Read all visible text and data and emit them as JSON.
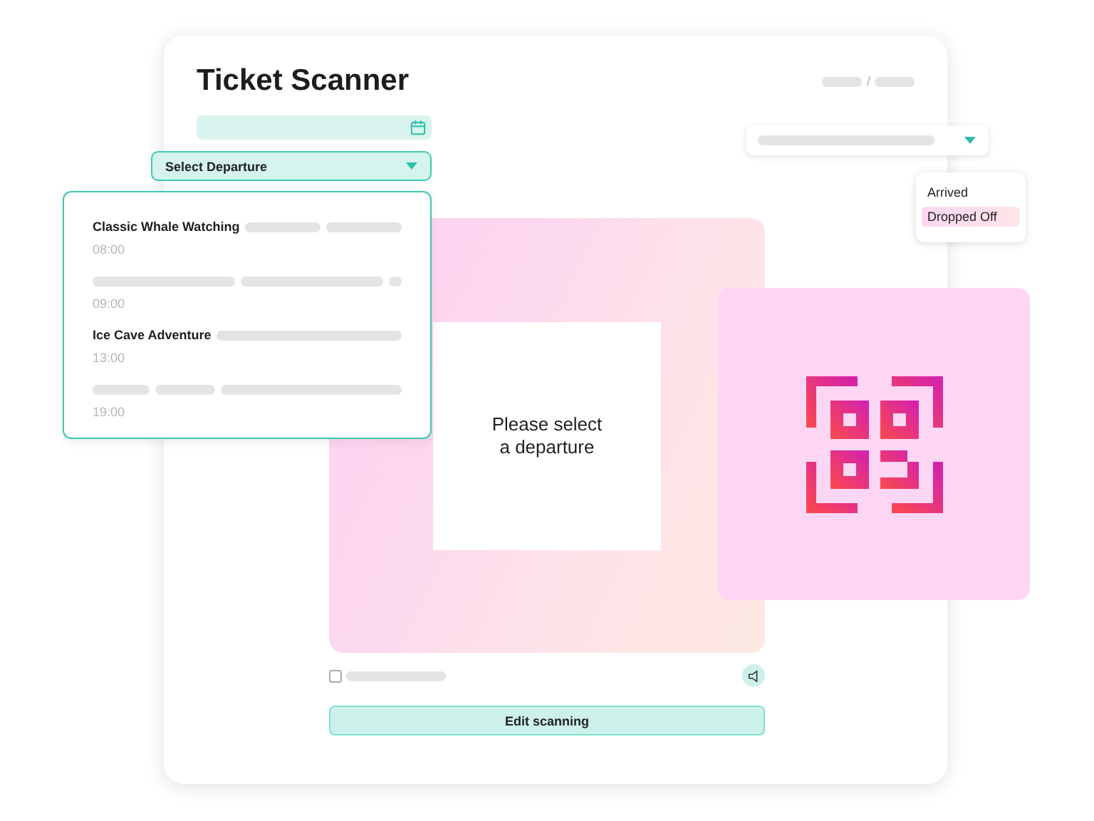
{
  "window": {
    "title": "Ticket Scanner"
  },
  "breadcrumb": {
    "separator": "/"
  },
  "departure_select": {
    "label": "Select Departure",
    "expanded": true
  },
  "departures": [
    {
      "name": "Classic Whale Watching",
      "time": "08:00"
    },
    {
      "time": "09:00"
    },
    {
      "name": "Ice Cave Adventure",
      "time": "13:00"
    },
    {
      "time": "19:00"
    }
  ],
  "status_options": [
    {
      "label": "Arrived",
      "selected": false
    },
    {
      "label": "Dropped Off",
      "selected": true
    }
  ],
  "scanner": {
    "message": "Please select\na departure"
  },
  "sound_checkbox": {
    "checked": false
  },
  "edit_button": "Edit scanning"
}
